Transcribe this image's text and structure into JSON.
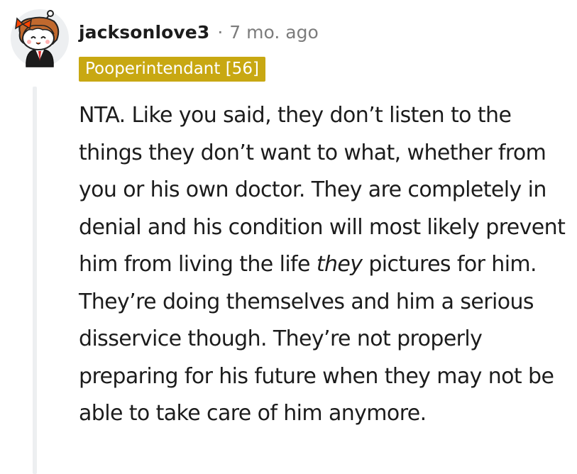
{
  "comment": {
    "username": "jacksonlove3",
    "separator": "·",
    "timestamp": "7 mo. ago",
    "flair": "Pooperintendant [56]",
    "body": {
      "part1": "NTA. Like you said, they don’t listen to the things they don’t want to what, whether from you or his own doctor. They are completely in denial and his condition will most likely prevent him from living the life ",
      "emphasis": "they",
      "part2": " pictures for him. They’re doing themselves and him a serious disservice though. They’re not properly preparing for his future when they may not be able to take care of him anymore."
    }
  },
  "colors": {
    "flair_background": "#c8a812",
    "muted_text": "#7c7c7c",
    "thread_line": "#edeff1",
    "avatar_hair": "#c1692e",
    "avatar_bow": "#ff4500"
  },
  "icons": {
    "avatar": "snoo-avatar-icon"
  }
}
